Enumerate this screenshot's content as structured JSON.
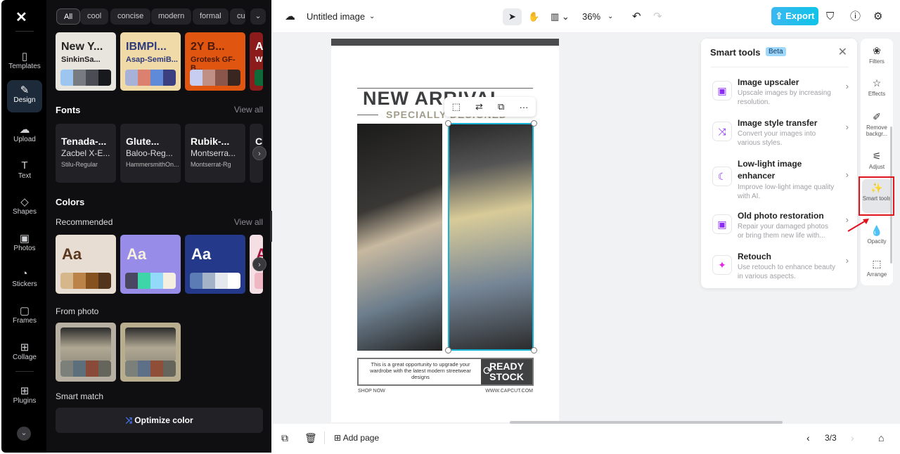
{
  "rail": {
    "items": [
      {
        "label": "Templates",
        "icon": "▯"
      },
      {
        "label": "Design",
        "icon": "✎"
      },
      {
        "label": "Upload",
        "icon": "☁"
      },
      {
        "label": "Text",
        "icon": "T"
      },
      {
        "label": "Shapes",
        "icon": "◇"
      },
      {
        "label": "Photos",
        "icon": "▣"
      },
      {
        "label": "Stickers",
        "icon": "◔"
      },
      {
        "label": "Frames",
        "icon": "▢"
      },
      {
        "label": "Collage",
        "icon": "⊞"
      },
      {
        "label": "Plugins",
        "icon": "⊞"
      }
    ],
    "more": "⌄"
  },
  "panel": {
    "chips": [
      "All",
      "cool",
      "concise",
      "modern",
      "formal",
      "cu"
    ],
    "themes": [
      {
        "t1": "New Y...",
        "t2": "SinkinSa...",
        "bg": "#e8e4de",
        "fg": "#222",
        "pal": [
          "#9cc6ef",
          "#787c80",
          "#4a4d53",
          "#17191c"
        ]
      },
      {
        "t1": "IBMPl...",
        "t2": "Asap-SemiB...",
        "bg": "#f0dba8",
        "fg": "#2e3a7c",
        "pal": [
          "#a8b1d8",
          "#dc8070",
          "#5f8ad7",
          "#3b3f80"
        ]
      },
      {
        "t1": "2Y B...",
        "t2": "Grotesk GF-B...",
        "bg": "#e05510",
        "fg": "#4a1a0a",
        "pal": [
          "#c7cdf0",
          "#c08f86",
          "#8a554a",
          "#3a2620"
        ]
      },
      {
        "t1": "An",
        "t2": "W",
        "bg": "#8c1c1c",
        "fg": "#fff",
        "pal": [
          "#0f6a3a",
          "#0f6a3a",
          "#0f6a3a",
          "#0f6a3a"
        ]
      }
    ],
    "fonts_title": "Fonts",
    "view_all": "View all",
    "fonts": [
      {
        "a": "Tenada-...",
        "b": "Zacbel X-E...",
        "c": "Stilu-Regular"
      },
      {
        "a": "Glute...",
        "b": "Baloo-Reg...",
        "c": "HammersmithOn..."
      },
      {
        "a": "Rubik-...",
        "b": "Montserra...",
        "c": "Montserrat-Rg"
      },
      {
        "a": "C",
        "b": "",
        "c": "Mo"
      }
    ],
    "colors_title": "Colors",
    "recommended": "Recommended",
    "colors": [
      {
        "aa": "Aa",
        "bg": "#e8ddd2",
        "fg": "#5a3820",
        "pal": [
          "#d6b78c",
          "#bb8347",
          "#84511f",
          "#52331c"
        ]
      },
      {
        "aa": "Aa",
        "bg": "#988ce9",
        "fg": "#f6f0df",
        "pal": [
          "#4a4763",
          "#3ed6a8",
          "#93d9fa",
          "#f4efe0"
        ]
      },
      {
        "aa": "Aa",
        "bg": "#25398a",
        "fg": "#fff",
        "pal": [
          "#5b7cb4",
          "#a4b3c8",
          "#e5e8ed",
          "#ffffff"
        ]
      },
      {
        "aa": "A",
        "bg": "#f3dfe4",
        "fg": "#a0153e",
        "pal": [
          "#efb6c4",
          "#efb6c4",
          "#efb6c4",
          "#efb6c4"
        ]
      }
    ],
    "from_photo": "From photo",
    "photos": [
      {
        "bg": "#b8afa3",
        "pal": [
          "#7b807b",
          "#5e6f7c",
          "#8a4a3a",
          "#66655c"
        ]
      },
      {
        "bg": "#b8ad8e",
        "pal": [
          "#7b807b",
          "#5e6f88",
          "#8e4e38",
          "#66655c"
        ]
      }
    ],
    "smart_match": "Smart match",
    "optimize": "Optimize color"
  },
  "topbar": {
    "title": "Untitled image",
    "zoom": "36%",
    "export": "Export"
  },
  "design": {
    "headline": "NEW ARRIVAL",
    "sub": "SPECIALLY DESIGNED",
    "blurb": "This is a great opportunity to upgrade your wardrobe with the latest modern streetwear designs",
    "ready": "READY",
    "stock": "STOCK",
    "shop": "SHOP NOW",
    "url": "WWW.CAPCUT.COM"
  },
  "smart_tools": {
    "title": "Smart tools",
    "badge": "Beta",
    "items": [
      {
        "title": "Image upscaler",
        "desc": "Upscale images by increasing resolution.",
        "icon": "▣"
      },
      {
        "title": "Image style transfer",
        "desc": "Convert your images into various styles.",
        "icon": "⤨"
      },
      {
        "title": "Low-light image enhancer",
        "desc": "Improve low-light image quality with AI.",
        "icon": "☾"
      },
      {
        "title": "Old photo restoration",
        "desc": "Repair your damaged photos or bring them new life with...",
        "icon": "▣"
      },
      {
        "title": "Retouch",
        "desc": "Use retouch to enhance beauty in various aspects.",
        "icon": "✦"
      }
    ]
  },
  "right_rail": [
    {
      "label": "Filters",
      "icon": "❀"
    },
    {
      "label": "Effects",
      "icon": "☆"
    },
    {
      "label": "Remove backgr...",
      "icon": "✐"
    },
    {
      "label": "Adjust",
      "icon": "⚟"
    },
    {
      "label": "Smart tools",
      "icon": "✨"
    },
    {
      "label": "Opacity",
      "icon": "💧"
    },
    {
      "label": "Arrange",
      "icon": "⬚"
    }
  ],
  "bottom": {
    "add_page": "Add page",
    "page": "3/3"
  },
  "colors": {
    "accent": "#10c3e8",
    "highlight": "#e0141e",
    "selection": "#17b3d6"
  }
}
